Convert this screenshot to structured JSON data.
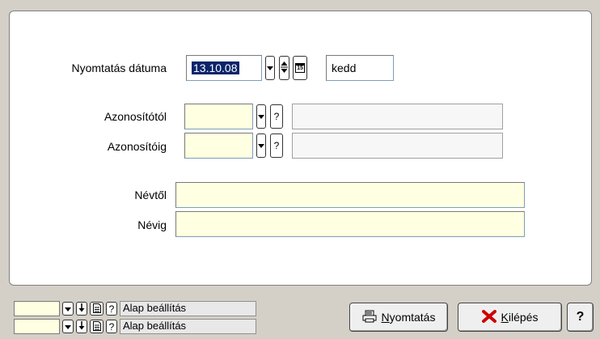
{
  "form": {
    "print_date_label": "Nyomtatás dátuma",
    "print_date_value": "13.10.08",
    "calendar_glyph": "15",
    "weekday_value": "kedd",
    "id_from_label": "Azonosítótól",
    "id_to_label": "Azonosítóig",
    "name_from_label": "Névtől",
    "name_to_label": "Névig",
    "question_glyph": "?"
  },
  "footer": {
    "rows": [
      {
        "label": "Alap beállítás"
      },
      {
        "label": "Alap beállítás"
      }
    ],
    "print_button": "Nyomtatás",
    "exit_button": "Kilépés",
    "help_button": "?"
  },
  "icons": {
    "dropdown": "chevron-down-icon",
    "spin": "spin-updown-icon",
    "calendar": "calendar-icon",
    "arrow_down": "arrow-down-icon",
    "document": "document-icon",
    "printer": "printer-icon",
    "close": "red-x-icon"
  },
  "colors": {
    "input_yellow": "#ffffe1",
    "selection": "#0a246a",
    "exit_x": "#cc0000"
  }
}
